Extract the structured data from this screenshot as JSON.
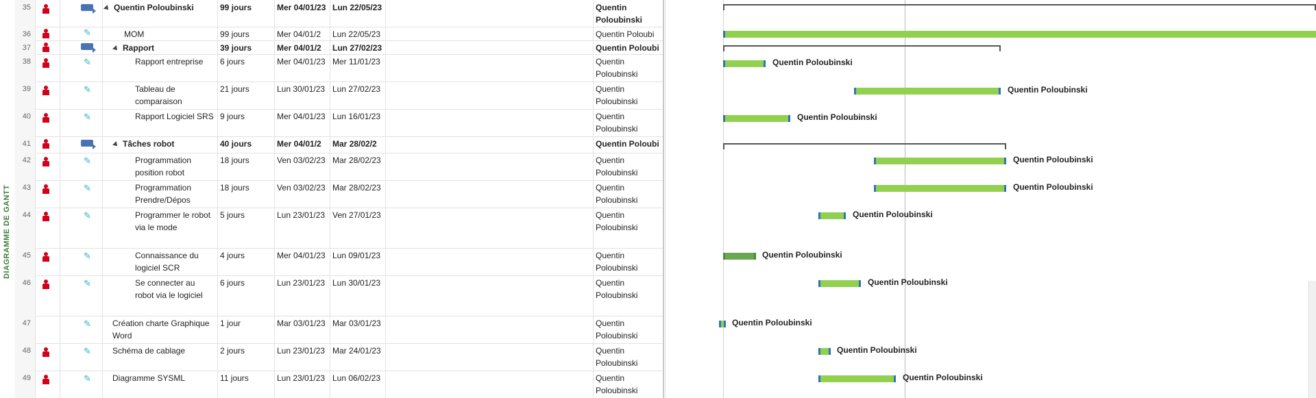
{
  "side_label": "DIAGRAMME DE GANTT",
  "rows": [
    {
      "id": "35",
      "name": "Quentin Poloubinski",
      "dur": "99 jours",
      "start": "Mer 04/01/23",
      "end": "Lun 22/05/23",
      "res": "Quentin Poloubinski",
      "type": "summary",
      "indent": 0
    },
    {
      "id": "36",
      "name": "MOM",
      "dur": "99 jours",
      "start": "Mer 04/01/2",
      "end": "Lun 22/05/23",
      "res": "Quentin Poloubi",
      "type": "task",
      "indent": 1
    },
    {
      "id": "37",
      "name": "Rapport",
      "dur": "39 jours",
      "start": "Mer 04/01/2",
      "end": "Lun 27/02/23",
      "res": "Quentin Poloubi",
      "type": "summary",
      "indent": 1
    },
    {
      "id": "38",
      "name": "Rapport entreprise",
      "dur": "6 jours",
      "start": "Mer 04/01/23",
      "end": "Mer 11/01/23",
      "res": "Quentin Poloubinski",
      "type": "task",
      "indent": 2
    },
    {
      "id": "39",
      "name": "Tableau de comparaison",
      "dur": "21 jours",
      "start": "Lun 30/01/23",
      "end": "Lun 27/02/23",
      "res": "Quentin Poloubinski",
      "type": "task",
      "indent": 2
    },
    {
      "id": "40",
      "name": "Rapport Logiciel SRS",
      "dur": "9 jours",
      "start": "Mer 04/01/23",
      "end": "Lun 16/01/23",
      "res": "Quentin Poloubinski",
      "type": "task",
      "indent": 2
    },
    {
      "id": "41",
      "name": "Tâches robot",
      "dur": "40 jours",
      "start": "Mer 04/01/2",
      "end": "Mar 28/02/2",
      "res": "Quentin Poloubi",
      "type": "summary",
      "indent": 1
    },
    {
      "id": "42",
      "name": "Programmation position robot",
      "dur": "18 jours",
      "start": "Ven 03/02/23",
      "end": "Mar 28/02/23",
      "res": "Quentin Poloubinski",
      "type": "task",
      "indent": 2
    },
    {
      "id": "43",
      "name": "Programmation Prendre/Dépos",
      "dur": "18 jours",
      "start": "Ven 03/02/23",
      "end": "Mar 28/02/23",
      "res": "Quentin Poloubinski",
      "type": "task",
      "indent": 2
    },
    {
      "id": "44",
      "name": "Programmer le robot via le mode",
      "dur": "5 jours",
      "start": "Lun 23/01/23",
      "end": "Ven 27/01/23",
      "res": "Quentin Poloubinski",
      "type": "task",
      "indent": 2
    },
    {
      "id": "45",
      "name": "Connaissance du logiciel SCR",
      "dur": "4 jours",
      "start": "Mer 04/01/23",
      "end": "Lun 09/01/23",
      "res": "Quentin Poloubinski",
      "type": "task",
      "indent": 2
    },
    {
      "id": "46",
      "name": "Se connecter au robot via le logiciel",
      "dur": "6 jours",
      "start": "Lun 23/01/23",
      "end": "Lun 30/01/23",
      "res": "Quentin Poloubinski",
      "type": "task",
      "indent": 2
    },
    {
      "id": "47",
      "name": "Création charte Graphique Word",
      "dur": "1 jour",
      "start": "Mar 03/01/23",
      "end": "Mar 03/01/23",
      "res": "Quentin Poloubinski",
      "type": "task",
      "indent": 0
    },
    {
      "id": "48",
      "name": "Schéma de cablage",
      "dur": "2 jours",
      "start": "Lun 23/01/23",
      "end": "Mar 24/01/23",
      "res": "Quentin Poloubinski",
      "type": "task",
      "indent": 0
    },
    {
      "id": "49",
      "name": "Diagramme SYSML",
      "dur": "11 jours",
      "start": "Lun 23/01/23",
      "end": "Lun 06/02/23",
      "res": "Quentin Poloubinski",
      "type": "task",
      "indent": 0
    }
  ],
  "gantt_labels": [
    "Quentin Poloubinski",
    "Quentin Poloubinski",
    "Quentin Poloubinski",
    "Quentin Poloubinski",
    "Quentin Poloubinski",
    "Quentin Poloubinski",
    "Quentin Poloubinski",
    "Quentin Poloubinski",
    "Quentin Poloubinski",
    "Quentin Poloubinski",
    "Quentin Poloubinski"
  ]
}
